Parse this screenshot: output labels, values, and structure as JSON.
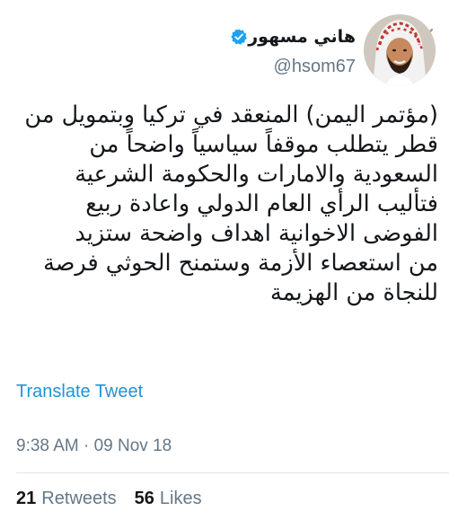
{
  "profile": {
    "display_name": "هاني مسهور",
    "handle": "@hsom67",
    "verified": true,
    "avatar": "user-avatar"
  },
  "tweet": {
    "lines": [
      "(مؤتمر اليمن) المنعقد في تركيا وبتمويل من",
      "قطر يتطلب موقفاً سياسياً واضحاً من",
      "السعودية والامارات والحكومة الشرعية",
      "فتأليب الرأي العام الدولي واعادة ربيع",
      "الفوضى الاخوانية اهداف واضحة ستزيد",
      "من استعصاء الأزمة وستمنح الحوثي فرصة",
      "للنجاة من الهزيمة"
    ],
    "translate_label": "Translate Tweet",
    "timestamp": "9:38 AM · 09 Nov 18"
  },
  "stats": {
    "retweets_count": "21",
    "retweets_label": "Retweets",
    "likes_count": "56",
    "likes_label": "Likes"
  },
  "icons": {
    "menu": "chevron-down-icon",
    "verified": "verified-badge-icon"
  },
  "colors": {
    "link": "#1d95d8",
    "secondary_text": "#657786",
    "primary_text": "#14171a",
    "verified_badge": "#1da1f2"
  }
}
